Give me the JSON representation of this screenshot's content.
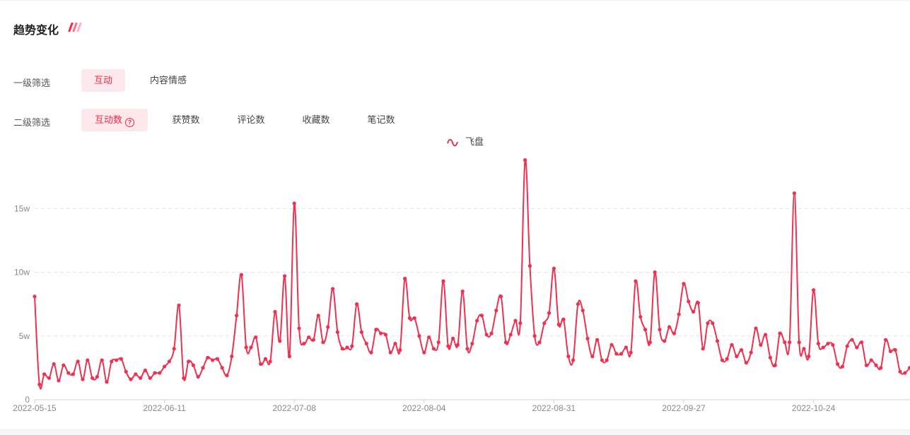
{
  "header": {
    "title": "趋势变化"
  },
  "filters": {
    "level1": {
      "label": "一级筛选",
      "options": [
        "互动",
        "内容情感"
      ],
      "active": 0
    },
    "level2": {
      "label": "二级筛选",
      "options": [
        "互动数",
        "获赞数",
        "评论数",
        "收藏数",
        "笔记数"
      ],
      "active": 0
    }
  },
  "colors": {
    "accent": "#ff2442",
    "line": "#f0304f"
  },
  "chart_data": {
    "type": "line",
    "title": "",
    "legend": {
      "position": "top-center",
      "entries": [
        "飞盘"
      ]
    },
    "grid": true,
    "ylim": [
      0,
      20
    ],
    "y_unit": "w",
    "yticks": [
      {
        "value": 0,
        "label": "0"
      },
      {
        "value": 5,
        "label": "5w"
      },
      {
        "value": 10,
        "label": "10w"
      },
      {
        "value": 15,
        "label": "15w"
      }
    ],
    "xticks": [
      "2022-05-15",
      "2022-06-11",
      "2022-07-08",
      "2022-08-04",
      "2022-08-31",
      "2022-09-27",
      "2022-10-24"
    ],
    "x_start": "2022-05-15",
    "series": [
      {
        "name": "飞盘",
        "values": [
          8.1,
          1.2,
          2.0,
          1.7,
          2.8,
          1.5,
          2.7,
          2.1,
          2.0,
          3.0,
          1.6,
          3.1,
          1.7,
          1.8,
          3.1,
          1.4,
          3.0,
          3.1,
          3.2,
          2.2,
          1.6,
          2.0,
          1.7,
          2.3,
          1.7,
          2.1,
          2.1,
          2.6,
          3.0,
          4.0,
          7.4,
          1.7,
          3.0,
          2.7,
          1.8,
          2.5,
          3.3,
          3.1,
          3.2,
          2.5,
          1.9,
          3.4,
          6.6,
          9.8,
          4.1,
          4.1,
          4.9,
          2.8,
          3.2,
          3.0,
          6.9,
          4.6,
          9.7,
          3.4,
          15.4,
          5.6,
          4.4,
          4.9,
          4.7,
          6.6,
          4.5,
          5.7,
          8.7,
          5.3,
          4.0,
          4.1,
          4.2,
          7.5,
          5.3,
          4.4,
          3.7,
          5.5,
          5.2,
          5.1,
          3.7,
          4.4,
          3.9,
          9.5,
          6.4,
          6.4,
          5.0,
          3.7,
          4.9,
          4.0,
          4.5,
          9.3,
          4.2,
          4.8,
          4.3,
          8.5,
          4.0,
          4.4,
          6.2,
          6.6,
          5.1,
          5.2,
          7.0,
          8.1,
          4.5,
          5.1,
          6.2,
          6.0,
          18.8,
          10.5,
          5.0,
          4.5,
          6.0,
          6.8,
          10.3,
          5.9,
          6.3,
          3.4,
          3.1,
          7.5,
          7.0,
          4.8,
          3.4,
          4.7,
          3.1,
          3.1,
          4.3,
          3.6,
          3.6,
          4.1,
          3.7,
          9.3,
          6.5,
          5.5,
          4.5,
          10.0,
          5.5,
          4.6,
          5.7,
          5.2,
          6.7,
          9.1,
          7.7,
          6.9,
          7.6,
          4.0,
          6.0,
          6.0,
          4.6,
          3.1,
          3.2,
          4.3,
          3.4,
          3.9,
          2.9,
          3.7,
          5.6,
          4.3,
          5.1,
          3.3,
          2.7,
          5.2,
          4.5,
          4.5,
          16.2,
          4.5,
          4.0,
          3.4,
          8.6,
          4.4,
          4.1,
          4.4,
          4.3,
          2.8,
          2.6,
          4.2,
          4.7,
          4.1,
          4.5,
          2.7,
          3.1,
          2.7,
          2.5,
          4.7,
          3.8,
          3.9,
          2.2,
          2.1,
          2.5
        ]
      }
    ]
  }
}
